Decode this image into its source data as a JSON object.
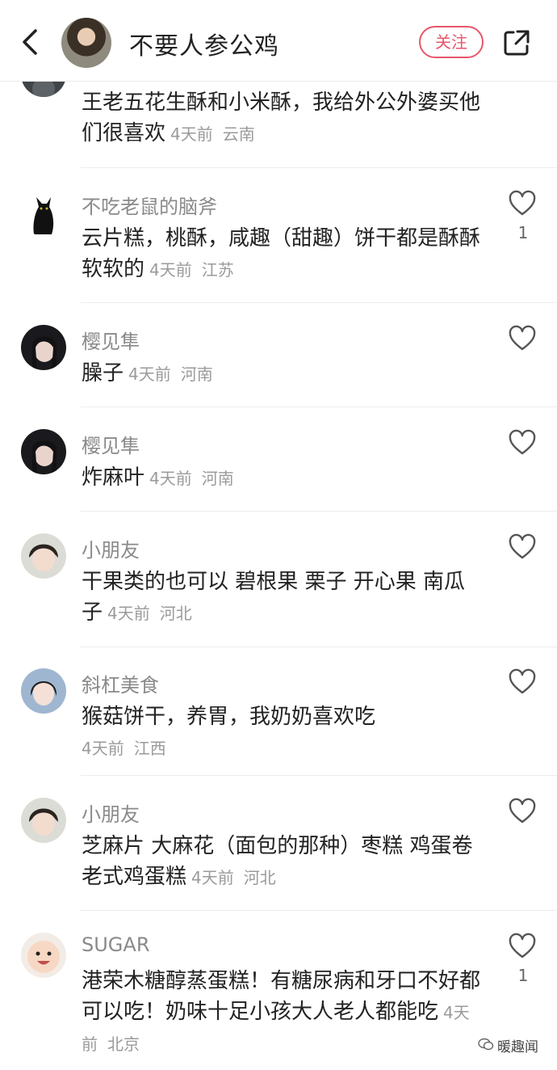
{
  "header": {
    "title": "不要人参公鸡",
    "follow_label": "关注"
  },
  "comments": [
    {
      "name": "",
      "text": "王老五花生酥和小米酥，我给外公外婆买他们很喜欢",
      "time": "4天前",
      "location": "云南",
      "likes": ""
    },
    {
      "name": "不吃老鼠的脑斧",
      "text": "云片糕，桃酥，咸趣（甜趣）饼干都是酥酥软软的",
      "time": "4天前",
      "location": "江苏",
      "likes": "1"
    },
    {
      "name": "樱见隼",
      "text": "臊子",
      "time": "4天前",
      "location": "河南",
      "likes": ""
    },
    {
      "name": "樱见隼",
      "text": "炸麻叶",
      "time": "4天前",
      "location": "河南",
      "likes": ""
    },
    {
      "name": "小朋友",
      "text": "干果类的也可以 碧根果 栗子 开心果 南瓜子",
      "time": "4天前",
      "location": "河北",
      "likes": ""
    },
    {
      "name": "斜杠美食",
      "text": "猴菇饼干，养胃，我奶奶喜欢吃",
      "time": "4天前",
      "location": "江西",
      "likes": ""
    },
    {
      "name": "小朋友",
      "text": "芝麻片 大麻花（面包的那种）枣糕 鸡蛋卷 老式鸡蛋糕",
      "time": "4天前",
      "location": "河北",
      "likes": ""
    },
    {
      "name": "SUGAR",
      "text": "港荣木糖醇蒸蛋糕！有糖尿病和牙口不好都可以吃！奶味十足小孩大人老人都能吃",
      "time": "4天前",
      "location": "北京",
      "likes": "1"
    }
  ],
  "watermark": "暖趣闻",
  "colors": {
    "accent": "#e8566a",
    "meta": "#9a9a9a",
    "name": "#8a8a8a"
  }
}
